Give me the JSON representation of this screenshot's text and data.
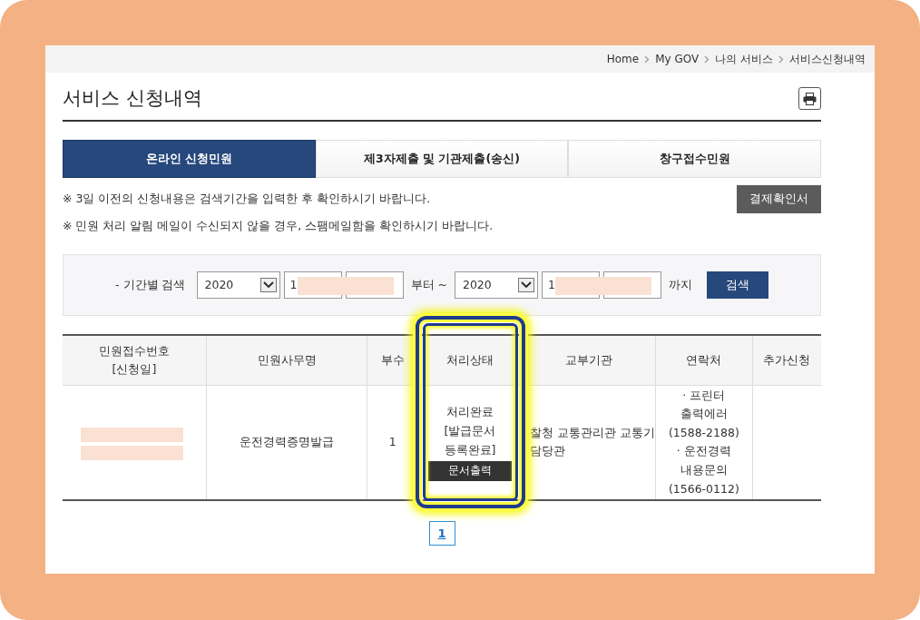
{
  "breadcrumb": [
    {
      "label": "Home"
    },
    {
      "label": "My GOV"
    },
    {
      "label": "나의 서비스"
    },
    {
      "label": "서비스신청내역"
    }
  ],
  "title": "서비스 신청내역",
  "tabs": [
    {
      "label": "온라인 신청민원",
      "selected": true
    },
    {
      "label": "제3자제출 및 기관제출(송신)",
      "selected": false
    },
    {
      "label": "창구접수민원",
      "selected": false
    }
  ],
  "notices": [
    "※ 3일 이전의 신청내용은 검색기간을 입력한 후 확인하시기 바랍니다.",
    "※ 민원 처리 알림 메일이 수신되지 않을 경우, 스팸메일함을 확인하시기 바랍니다."
  ],
  "receipt_button": "결제확인서",
  "search": {
    "label": "- 기간별 검색",
    "from": {
      "year": "2020",
      "month": {
        "value": "1",
        "redacted": true
      },
      "day": {
        "redacted": true
      }
    },
    "from_suffix": "부터 ~",
    "to": {
      "year": "2020",
      "month": {
        "value": "1",
        "redacted": true
      },
      "day": {
        "redacted": true
      }
    },
    "to_suffix": "까지",
    "button": "검색"
  },
  "table": {
    "columns": [
      {
        "label": "민원접수번호\n[신청일]",
        "highlighted": false
      },
      {
        "label": "민원사무명",
        "highlighted": false
      },
      {
        "label": "부수",
        "highlighted": false
      },
      {
        "label": "처리상태",
        "highlighted": true
      },
      {
        "label": "교부기관",
        "highlighted": false
      },
      {
        "label": "연락처",
        "highlighted": false
      },
      {
        "label": "추가신청",
        "highlighted": false
      }
    ],
    "rows": [
      {
        "receipt_no": {
          "redacted": true
        },
        "name": "운전경력증명발급",
        "copies": "1",
        "status": "처리완료\n[발급문서\n등록완료]",
        "status_button": "문서출력",
        "agency": "찰청 교통관리관 교통기\n담당관",
        "contact": "· 프린터\n출력에러\n(1588-2188)\n· 운전경력\n내용문의\n(1566-0112)"
      }
    ]
  },
  "pagination": [
    {
      "label": "1",
      "selected": true
    }
  ]
}
